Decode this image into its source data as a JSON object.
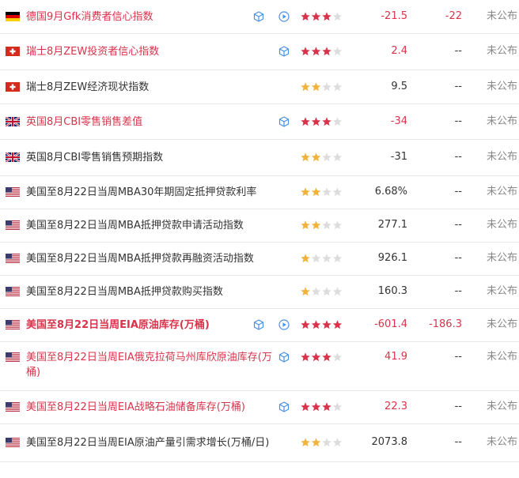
{
  "colors": {
    "red_text": "#d9334b",
    "normal_text": "#333333",
    "muted_text": "#888888",
    "star_active_red": "#d9334b",
    "star_active_gold": "#f2b33d",
    "star_inactive": "#dddddd",
    "icon_blue": "#4a90e2"
  },
  "rows": [
    {
      "flag": "germany-flag-icon",
      "name": "德国9月Gfk消费者信心指数",
      "red": true,
      "bold": false,
      "icons": [
        "cube-icon",
        "play-icon"
      ],
      "stars": 3,
      "actual": "-21.5",
      "forecast": "-22",
      "previous": "未公布"
    },
    {
      "flag": "switzerland-flag-icon",
      "name": "瑞士8月ZEW投资者信心指数",
      "red": true,
      "bold": false,
      "icons": [
        "cube-icon"
      ],
      "stars": 3,
      "actual": "2.4",
      "forecast": "--",
      "previous": "未公布"
    },
    {
      "flag": "switzerland-flag-icon",
      "name": "瑞士8月ZEW经济现状指数",
      "red": false,
      "bold": false,
      "icons": [],
      "stars": 2,
      "actual": "9.5",
      "forecast": "--",
      "previous": "未公布"
    },
    {
      "flag": "uk-flag-icon",
      "name": "英国8月CBI零售销售差值",
      "red": true,
      "bold": false,
      "icons": [
        "cube-icon"
      ],
      "stars": 3,
      "actual": "-34",
      "forecast": "--",
      "previous": "未公布"
    },
    {
      "flag": "uk-flag-icon",
      "name": "英国8月CBI零售销售预期指数",
      "red": false,
      "bold": false,
      "icons": [],
      "stars": 2,
      "actual": "-31",
      "forecast": "--",
      "previous": "未公布"
    },
    {
      "flag": "usa-flag-icon",
      "name": "美国至8月22日当周MBA30年期固定抵押贷款利率",
      "red": false,
      "bold": false,
      "icons": [],
      "stars": 2,
      "actual": "6.68%",
      "forecast": "--",
      "previous": "未公布"
    },
    {
      "flag": "usa-flag-icon",
      "name": "美国至8月22日当周MBA抵押贷款申请活动指数",
      "red": false,
      "bold": false,
      "icons": [],
      "stars": 2,
      "actual": "277.1",
      "forecast": "--",
      "previous": "未公布"
    },
    {
      "flag": "usa-flag-icon",
      "name": "美国至8月22日当周MBA抵押贷款再融资活动指数",
      "red": false,
      "bold": false,
      "icons": [],
      "stars": 1,
      "actual": "926.1",
      "forecast": "--",
      "previous": "未公布"
    },
    {
      "flag": "usa-flag-icon",
      "name": "美国至8月22日当周MBA抵押贷款购买指数",
      "red": false,
      "bold": false,
      "icons": [],
      "stars": 1,
      "actual": "160.3",
      "forecast": "--",
      "previous": "未公布"
    },
    {
      "flag": "usa-flag-icon",
      "name": "美国至8月22日当周EIA原油库存(万桶)",
      "red": true,
      "bold": true,
      "icons": [
        "cube-icon",
        "play-icon"
      ],
      "stars": 4,
      "actual": "-601.4",
      "forecast": "-186.3",
      "previous": "未公布"
    },
    {
      "flag": "usa-flag-icon",
      "name": "美国至8月22日当周EIA俄克拉荷马州库欣原油库存(万桶)",
      "red": true,
      "bold": false,
      "icons": [
        "cube-icon"
      ],
      "stars": 3,
      "actual": "41.9",
      "forecast": "--",
      "previous": "未公布"
    },
    {
      "flag": "usa-flag-icon",
      "name": "美国至8月22日当周EIA战略石油储备库存(万桶)",
      "red": true,
      "bold": false,
      "icons": [
        "cube-icon"
      ],
      "stars": 3,
      "actual": "22.3",
      "forecast": "--",
      "previous": "未公布"
    },
    {
      "flag": "usa-flag-icon",
      "name": "美国至8月22日当周EIA原油产量引需求增长(万桶/日)",
      "red": false,
      "bold": false,
      "icons": [],
      "stars": 2,
      "actual": "2073.8",
      "forecast": "--",
      "previous": "未公布"
    }
  ]
}
